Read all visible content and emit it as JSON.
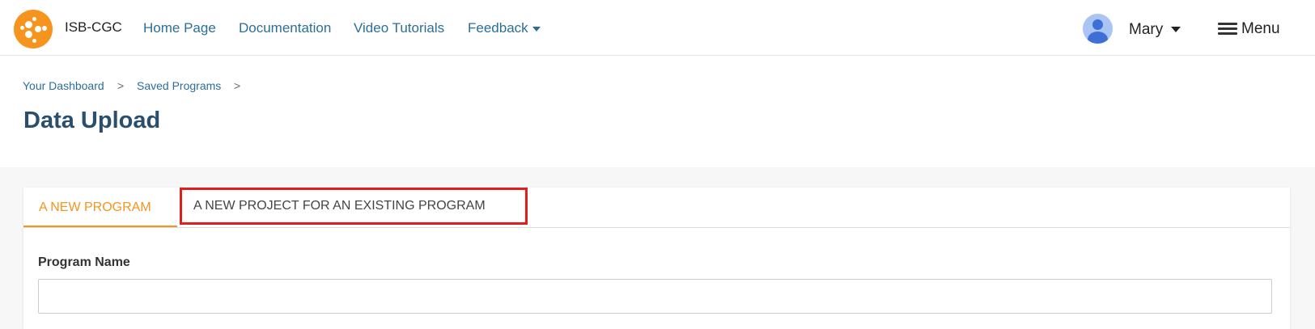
{
  "nav": {
    "brand": "ISB-CGC",
    "links": [
      "Home Page",
      "Documentation",
      "Video Tutorials",
      "Feedback"
    ],
    "user_name": "Mary",
    "menu_label": "Menu",
    "brand_color": "#f7941d",
    "link_color": "#2a6f97"
  },
  "breadcrumb": {
    "items": [
      "Your Dashboard",
      "Saved Programs"
    ],
    "separator": ">"
  },
  "page": {
    "title": "Data Upload"
  },
  "tabs": [
    {
      "label": "A NEW PROGRAM",
      "active": true
    },
    {
      "label": "A NEW PROJECT FOR AN EXISTING PROGRAM",
      "active": false,
      "highlighted": true
    }
  ],
  "form": {
    "program_name_label": "Program Name",
    "program_name_value": "",
    "program_name_placeholder": ""
  },
  "colors": {
    "highlight_box": "#e01e1e",
    "title": "#2a4f6e"
  }
}
